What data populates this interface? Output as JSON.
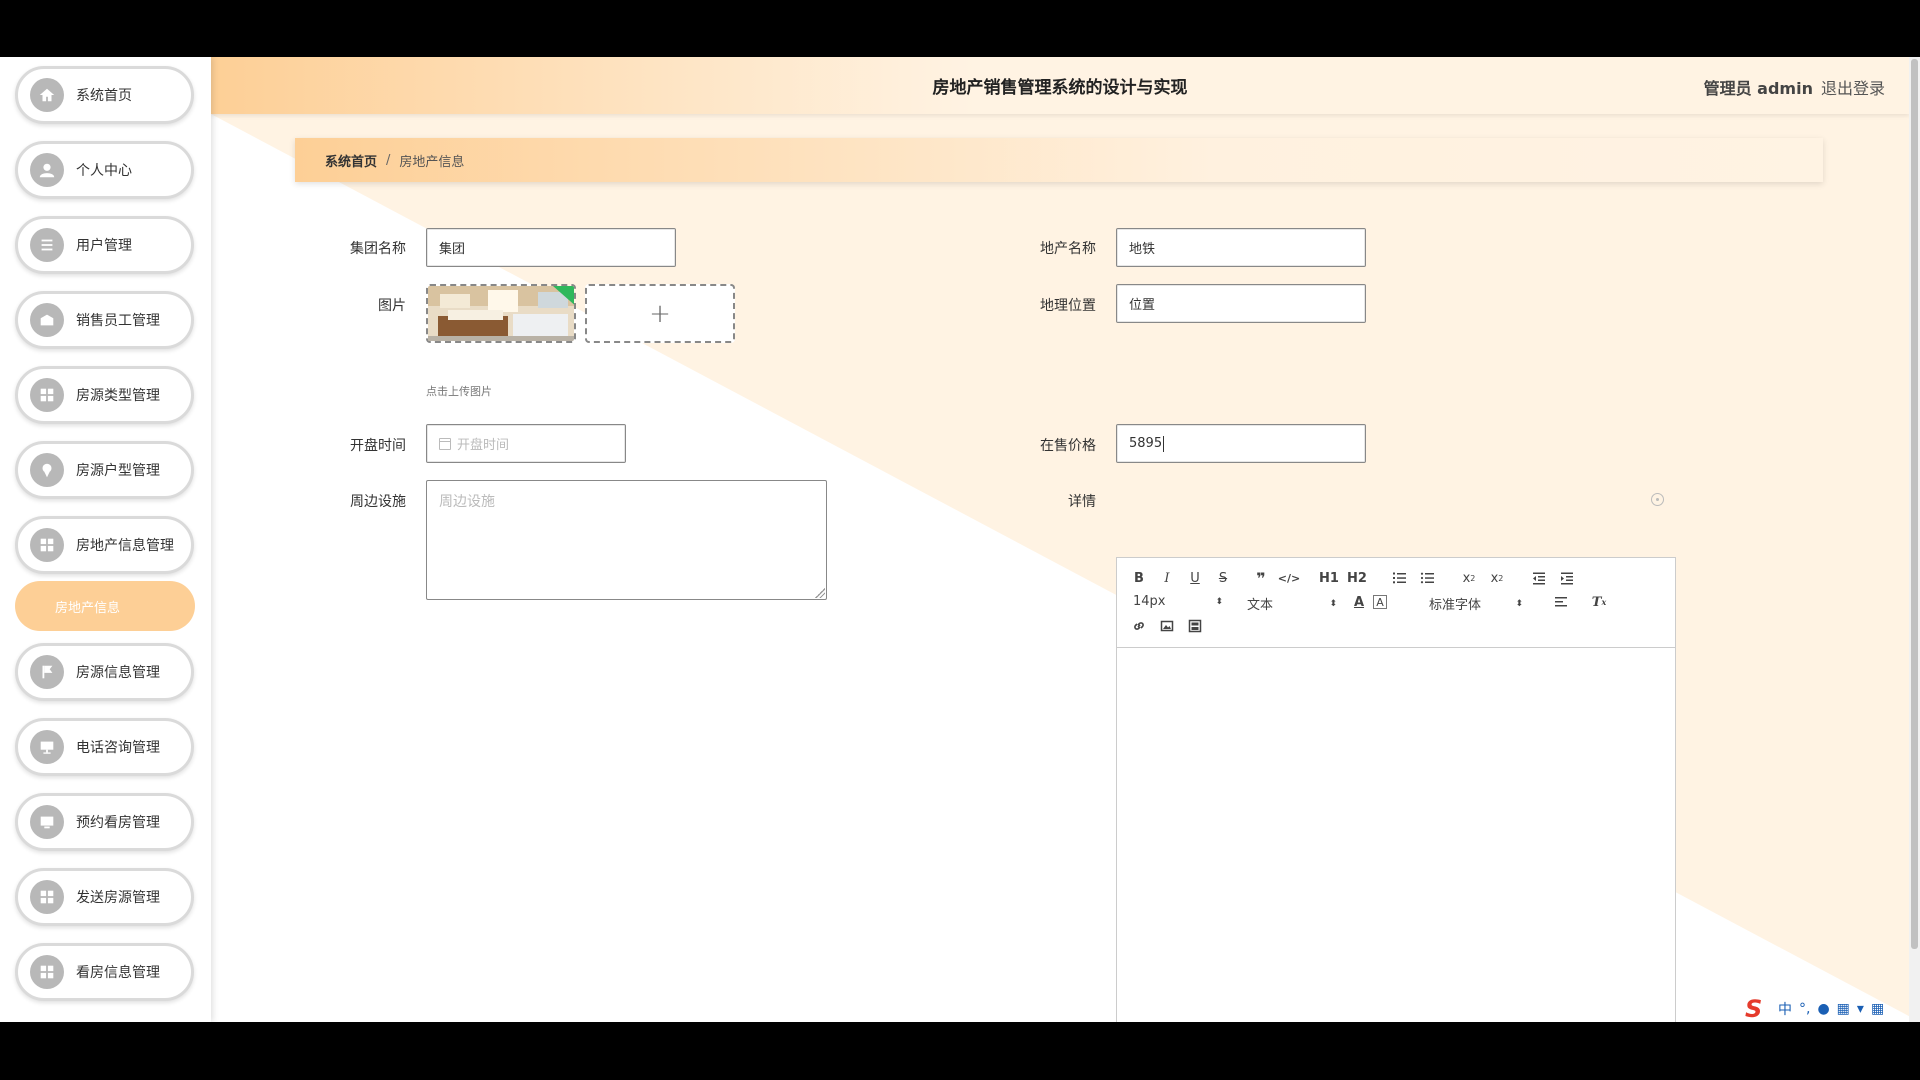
{
  "app": {
    "title": "房地产销售管理系统的设计与实现",
    "user_label": "管理员 admin",
    "logout_label": "退出登录"
  },
  "sidebar": {
    "items": [
      {
        "label": "系统首页",
        "icon": "home-icon"
      },
      {
        "label": "个人中心",
        "icon": "user-icon"
      },
      {
        "label": "用户管理",
        "icon": "list-icon"
      },
      {
        "label": "销售员工管理",
        "icon": "briefcase-icon"
      },
      {
        "label": "房源类型管理",
        "icon": "grid-icon"
      },
      {
        "label": "房源户型管理",
        "icon": "pin-icon"
      },
      {
        "label": "房地产信息管理",
        "icon": "grid-icon"
      },
      {
        "label": "房源信息管理",
        "icon": "flag-icon"
      },
      {
        "label": "电话咨询管理",
        "icon": "monitor-icon"
      },
      {
        "label": "预约看房管理",
        "icon": "screen-icon"
      },
      {
        "label": "发送房源管理",
        "icon": "grid-icon"
      },
      {
        "label": "看房信息管理",
        "icon": "grid-icon"
      }
    ],
    "sub_item": "房地产信息"
  },
  "breadcrumb": {
    "home": "系统首页",
    "separator": "/",
    "current": "房地产信息"
  },
  "form": {
    "group_name": {
      "label": "集团名称",
      "value": "集团"
    },
    "estate_name": {
      "label": "地产名称",
      "value": "地铁"
    },
    "image": {
      "label": "图片",
      "tip": "点击上传图片"
    },
    "location": {
      "label": "地理位置",
      "value": "位置"
    },
    "open_time": {
      "label": "开盘时间",
      "placeholder": "开盘时间"
    },
    "price": {
      "label": "在售价格",
      "value": "5895"
    },
    "facilities": {
      "label": "周边设施",
      "placeholder": "周边设施"
    },
    "details": {
      "label": "详情"
    }
  },
  "editor": {
    "font_size": "14px",
    "block_format": "文本",
    "font_family": "标准字体",
    "h1": "H1",
    "h2": "H2"
  },
  "ime": {
    "lang": "中"
  },
  "colors": {
    "accent": "#fdcf96",
    "accent_light": "#fff3e3"
  }
}
